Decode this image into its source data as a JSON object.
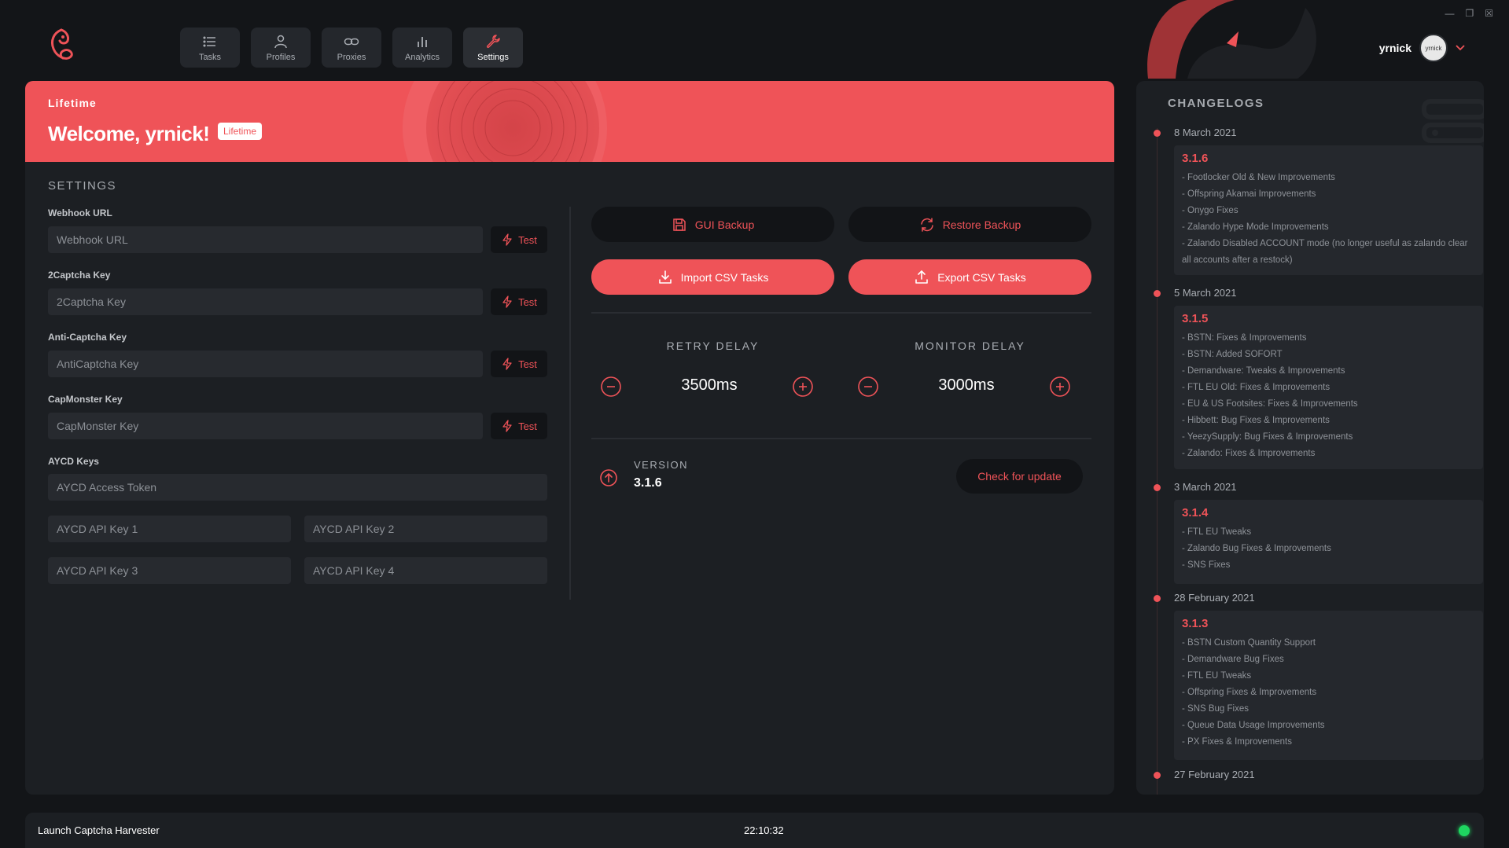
{
  "nav": {
    "items": [
      {
        "label": "Tasks",
        "icon": "list-icon"
      },
      {
        "label": "Profiles",
        "icon": "user-icon"
      },
      {
        "label": "Proxies",
        "icon": "link-icon"
      },
      {
        "label": "Analytics",
        "icon": "bar-chart-icon"
      },
      {
        "label": "Settings",
        "icon": "wrench-icon",
        "active": true
      }
    ]
  },
  "user": {
    "name": "yrnick",
    "avatar_text": "yrnick"
  },
  "banner": {
    "tag": "Lifetime",
    "title": "Welcome, yrnick!",
    "badge": "Lifetime"
  },
  "settings": {
    "title": "SETTINGS",
    "webhook": {
      "label": "Webhook URL",
      "placeholder": "Webhook URL"
    },
    "twocaptcha": {
      "label": "2Captcha Key",
      "placeholder": "2Captcha Key"
    },
    "anticaptcha": {
      "label": "Anti-Captcha Key",
      "placeholder": "AntiCaptcha Key"
    },
    "capmonster": {
      "label": "CapMonster Key",
      "placeholder": "CapMonster Key"
    },
    "test_label": "Test",
    "aycd": {
      "label": "AYCD Keys",
      "token_placeholder": "AYCD Access Token",
      "key1": "AYCD API Key 1",
      "key2": "AYCD API Key 2",
      "key3": "AYCD API Key 3",
      "key4": "AYCD API Key 4"
    }
  },
  "actions": {
    "gui_backup": "GUI Backup",
    "restore_backup": "Restore Backup",
    "import_csv": "Import CSV Tasks",
    "export_csv": "Export CSV Tasks"
  },
  "delays": {
    "retry": {
      "title": "RETRY DELAY",
      "value": "3500ms"
    },
    "monitor": {
      "title": "MONITOR DELAY",
      "value": "3000ms"
    }
  },
  "version": {
    "label": "VERSION",
    "value": "3.1.6",
    "update_label": "Check for update"
  },
  "changelog": {
    "title": "CHANGELOGS",
    "entries": [
      {
        "date": "8 March 2021",
        "version": "3.1.6",
        "items": [
          "- Footlocker Old & New Improvements",
          "- Offspring Akamai Improvements",
          "- Onygo Fixes",
          "- Zalando Hype Mode Improvements",
          "- Zalando Disabled ACCOUNT mode (no longer useful as zalando clear all accounts after a restock)"
        ]
      },
      {
        "date": "5 March 2021",
        "version": "3.1.5",
        "items": [
          "- BSTN: Fixes & Improvements",
          "- BSTN: Added SOFORT",
          "- Demandware: Tweaks & Improvements",
          "- FTL EU Old: Fixes & Improvements",
          "- EU & US Footsites: Fixes & Improvements",
          "- Hibbett: Bug Fixes & Improvements",
          "- YeezySupply: Bug Fixes & Improvements",
          "- Zalando: Fixes & Improvements"
        ]
      },
      {
        "date": "3 March 2021",
        "version": "3.1.4",
        "items": [
          "- FTL EU Tweaks",
          "- Zalando Bug Fixes & Improvements",
          "- SNS Fixes"
        ]
      },
      {
        "date": "28 February 2021",
        "version": "3.1.3",
        "items": [
          "- BSTN Custom Quantity Support",
          "- Demandware Bug Fixes",
          "- FTL EU Tweaks",
          "- Offspring Fixes & Improvements",
          "- SNS Bug Fixes",
          "- Queue Data Usage Improvements",
          "- PX Fixes & Improvements"
        ]
      },
      {
        "date": "27 February 2021"
      }
    ]
  },
  "footer": {
    "harvester_label": "Launch Captcha Harvester",
    "time": "22:10:32",
    "status_color": "#1ed760"
  },
  "colors": {
    "accent": "#ef5358",
    "background": "#131518",
    "panel": "#1c1f23"
  }
}
